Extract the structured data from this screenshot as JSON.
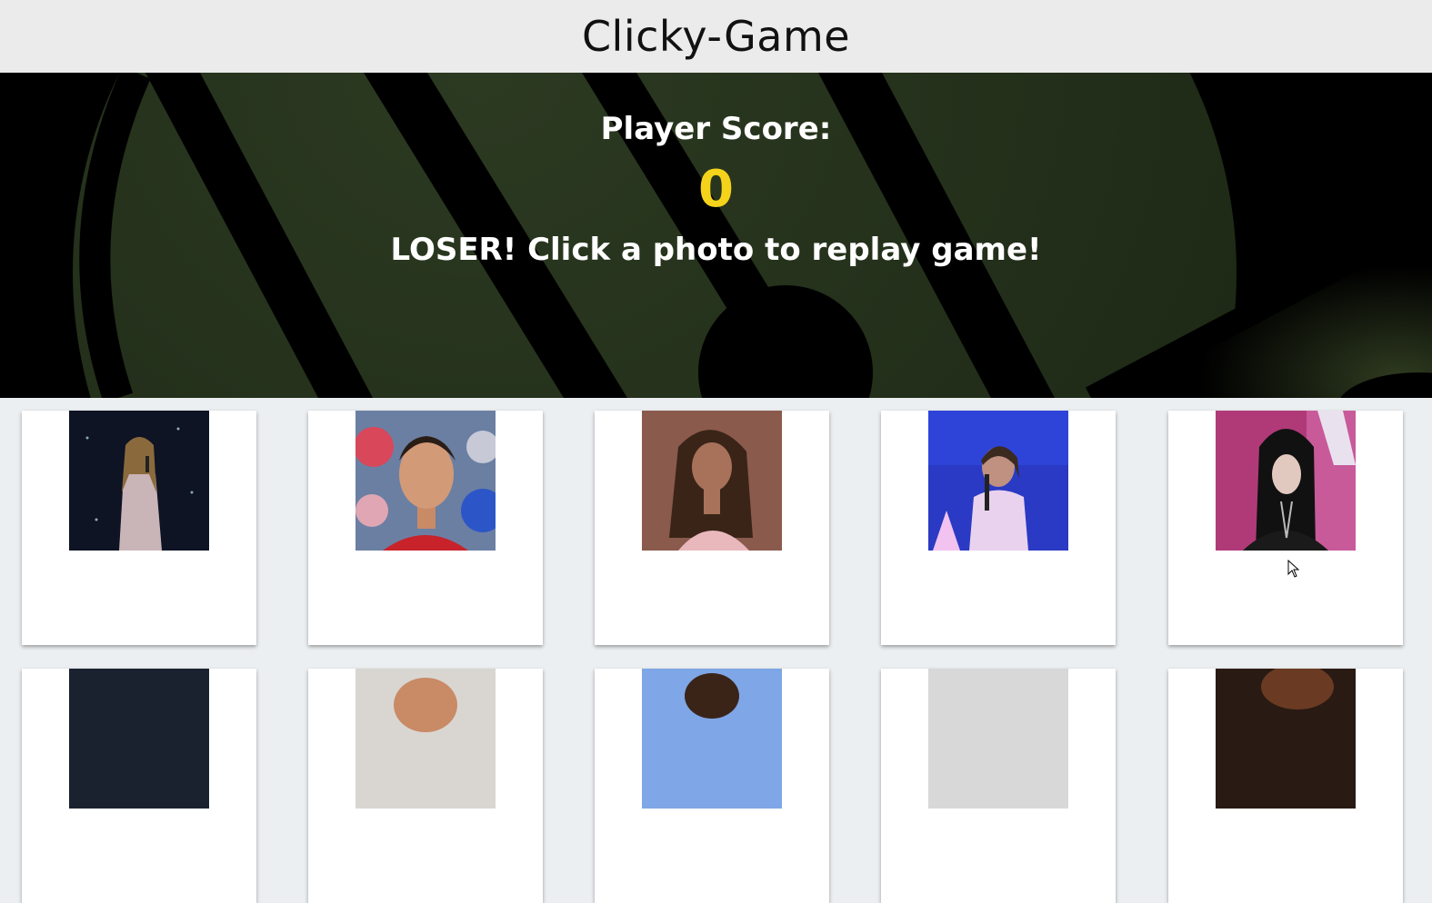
{
  "navbar": {
    "title": "Clicky-Game"
  },
  "hero": {
    "score_label": "Player Score:",
    "score_value": "0",
    "status_message": "LOSER! Click a photo to replay game!"
  },
  "colors": {
    "score": "#f5d31b",
    "navbar": "#ebebeb",
    "hero": "#000000",
    "hero_accent": "#2a3a1f",
    "page": "#eceff1"
  },
  "cards": [
    {
      "icon": "photo-performer-sparkle-gown-icon"
    },
    {
      "icon": "photo-soccer-player-icon"
    },
    {
      "icon": "photo-singer-pink-dress-icon"
    },
    {
      "icon": "photo-singer-blue-stage-icon"
    },
    {
      "icon": "photo-singer-dark-hair-icon"
    },
    {
      "icon": "photo-partial-1-icon"
    },
    {
      "icon": "photo-partial-2-icon"
    },
    {
      "icon": "photo-partial-3-icon"
    },
    {
      "icon": "photo-partial-4-icon"
    },
    {
      "icon": "photo-partial-5-icon"
    }
  ]
}
